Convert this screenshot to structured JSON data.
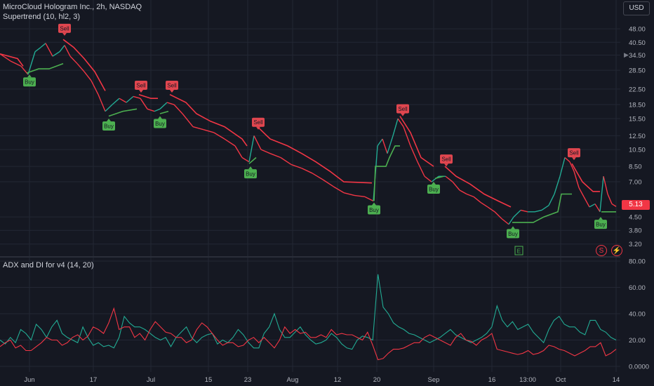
{
  "header": {
    "symbol_line": "MicroCloud Hologram Inc., 2h, NASDAQ",
    "indicator_line": "Supertrend (10, hl2, 3)",
    "lower_indicator_line": "ADX and DI for v4 (14, 20)"
  },
  "currency_button": "USD",
  "last_price": "5.13",
  "event_flags": [
    "S",
    "⚡"
  ],
  "earnings_marker": "E",
  "colors": {
    "background": "#151822",
    "up": "#22ab94",
    "down": "#f23645",
    "supertrend_up": "#4caf50",
    "supertrend_down": "#f23645",
    "grid": "#232734",
    "text": "#b2b5be"
  },
  "chart_data": [
    {
      "type": "line",
      "title": "MicroCloud Hologram Inc., 2h, NASDAQ",
      "scale": "log",
      "x_tick_labels": [
        "Jun",
        "17",
        "Jul",
        "15",
        "23",
        "Aug",
        "12",
        "20",
        "Sep",
        "16",
        "13:00",
        "Oct",
        "14"
      ],
      "y_tick_labels": [
        "48.00",
        "40.50",
        "34.50",
        "28.50",
        "22.50",
        "18.50",
        "15.50",
        "12.50",
        "10.50",
        "8.50",
        "7.00",
        "4.50",
        "3.80",
        "3.20"
      ],
      "ylim": [
        3.0,
        52.0
      ],
      "price_series": [
        {
          "x": 0,
          "y": 35
        },
        {
          "x": 15,
          "y": 32
        },
        {
          "x": 30,
          "y": 30
        },
        {
          "x": 40,
          "y": 27
        },
        {
          "x": 50,
          "y": 36
        },
        {
          "x": 58,
          "y": 38
        },
        {
          "x": 65,
          "y": 40
        },
        {
          "x": 75,
          "y": 34
        },
        {
          "x": 85,
          "y": 36
        },
        {
          "x": 92,
          "y": 39
        },
        {
          "x": 100,
          "y": 34
        },
        {
          "x": 110,
          "y": 31
        },
        {
          "x": 120,
          "y": 28
        },
        {
          "x": 130,
          "y": 25
        },
        {
          "x": 140,
          "y": 21
        },
        {
          "x": 150,
          "y": 17
        },
        {
          "x": 160,
          "y": 18.5
        },
        {
          "x": 170,
          "y": 20
        },
        {
          "x": 180,
          "y": 19
        },
        {
          "x": 190,
          "y": 20.5
        },
        {
          "x": 200,
          "y": 20
        },
        {
          "x": 210,
          "y": 17.5
        },
        {
          "x": 220,
          "y": 17
        },
        {
          "x": 228,
          "y": 17.5
        },
        {
          "x": 238,
          "y": 19
        },
        {
          "x": 248,
          "y": 18.5
        },
        {
          "x": 260,
          "y": 16.5
        },
        {
          "x": 275,
          "y": 14
        },
        {
          "x": 290,
          "y": 13.5
        },
        {
          "x": 305,
          "y": 13
        },
        {
          "x": 320,
          "y": 12
        },
        {
          "x": 335,
          "y": 11
        },
        {
          "x": 345,
          "y": 9.5
        },
        {
          "x": 355,
          "y": 9
        },
        {
          "x": 362,
          "y": 12.5
        },
        {
          "x": 372,
          "y": 10.5
        },
        {
          "x": 385,
          "y": 10
        },
        {
          "x": 400,
          "y": 9.5
        },
        {
          "x": 415,
          "y": 8.7
        },
        {
          "x": 430,
          "y": 8.3
        },
        {
          "x": 445,
          "y": 7.8
        },
        {
          "x": 460,
          "y": 7.2
        },
        {
          "x": 475,
          "y": 6.6
        },
        {
          "x": 490,
          "y": 6.1
        },
        {
          "x": 505,
          "y": 5.9
        },
        {
          "x": 520,
          "y": 5.8
        },
        {
          "x": 532,
          "y": 5.5
        },
        {
          "x": 538,
          "y": 11
        },
        {
          "x": 545,
          "y": 12
        },
        {
          "x": 552,
          "y": 10
        },
        {
          "x": 560,
          "y": 12.5
        },
        {
          "x": 567,
          "y": 15.5
        },
        {
          "x": 575,
          "y": 14
        },
        {
          "x": 585,
          "y": 11
        },
        {
          "x": 595,
          "y": 9
        },
        {
          "x": 605,
          "y": 7.5
        },
        {
          "x": 615,
          "y": 7
        },
        {
          "x": 625,
          "y": 7.5
        },
        {
          "x": 635,
          "y": 7.5
        },
        {
          "x": 645,
          "y": 7
        },
        {
          "x": 655,
          "y": 6.3
        },
        {
          "x": 665,
          "y": 6
        },
        {
          "x": 675,
          "y": 5.8
        },
        {
          "x": 685,
          "y": 5.4
        },
        {
          "x": 695,
          "y": 5.1
        },
        {
          "x": 705,
          "y": 4.8
        },
        {
          "x": 715,
          "y": 4.4
        },
        {
          "x": 725,
          "y": 4.1
        },
        {
          "x": 732,
          "y": 4.5
        },
        {
          "x": 742,
          "y": 4.9
        },
        {
          "x": 752,
          "y": 4.8
        },
        {
          "x": 762,
          "y": 4.8
        },
        {
          "x": 772,
          "y": 4.9
        },
        {
          "x": 782,
          "y": 5.2
        },
        {
          "x": 790,
          "y": 6
        },
        {
          "x": 798,
          "y": 7.5
        },
        {
          "x": 805,
          "y": 9.5
        },
        {
          "x": 812,
          "y": 9
        },
        {
          "x": 818,
          "y": 8
        },
        {
          "x": 825,
          "y": 6.5
        },
        {
          "x": 832,
          "y": 5.8
        },
        {
          "x": 840,
          "y": 5.1
        },
        {
          "x": 848,
          "y": 5.3
        },
        {
          "x": 855,
          "y": 4.8
        },
        {
          "x": 860,
          "y": 7.5
        },
        {
          "x": 866,
          "y": 6
        },
        {
          "x": 872,
          "y": 5.3
        },
        {
          "x": 878,
          "y": 5.13
        }
      ],
      "supertrend_segments": [
        {
          "dir": "down",
          "points": [
            {
              "x": 0,
              "y": 35
            },
            {
              "x": 25,
              "y": 33
            },
            {
              "x": 33,
              "y": 30
            }
          ]
        },
        {
          "dir": "up",
          "points": [
            {
              "x": 38,
              "y": 27.5
            },
            {
              "x": 55,
              "y": 29
            },
            {
              "x": 70,
              "y": 29
            },
            {
              "x": 90,
              "y": 31
            }
          ]
        },
        {
          "dir": "down",
          "points": [
            {
              "x": 90,
              "y": 42
            },
            {
              "x": 105,
              "y": 38
            },
            {
              "x": 120,
              "y": 33
            },
            {
              "x": 135,
              "y": 28
            },
            {
              "x": 150,
              "y": 22
            }
          ]
        },
        {
          "dir": "up",
          "points": [
            {
              "x": 155,
              "y": 16
            },
            {
              "x": 175,
              "y": 17
            },
            {
              "x": 195,
              "y": 17.5
            }
          ]
        },
        {
          "dir": "down",
          "points": [
            {
              "x": 198,
              "y": 21
            },
            {
              "x": 215,
              "y": 20
            },
            {
              "x": 225,
              "y": 20
            }
          ]
        },
        {
          "dir": "up",
          "points": [
            {
              "x": 228,
              "y": 16.5
            },
            {
              "x": 240,
              "y": 17
            }
          ]
        },
        {
          "dir": "down",
          "points": [
            {
              "x": 242,
              "y": 21
            },
            {
              "x": 265,
              "y": 19
            },
            {
              "x": 280,
              "y": 16.5
            },
            {
              "x": 300,
              "y": 15
            },
            {
              "x": 320,
              "y": 14
            },
            {
              "x": 345,
              "y": 12
            },
            {
              "x": 352,
              "y": 11
            }
          ]
        },
        {
          "dir": "up",
          "points": [
            {
              "x": 355,
              "y": 8.8
            },
            {
              "x": 365,
              "y": 9.5
            }
          ]
        },
        {
          "dir": "down",
          "points": [
            {
              "x": 367,
              "y": 14
            },
            {
              "x": 385,
              "y": 12
            },
            {
              "x": 410,
              "y": 11
            },
            {
              "x": 430,
              "y": 10
            },
            {
              "x": 450,
              "y": 9
            },
            {
              "x": 470,
              "y": 8
            },
            {
              "x": 490,
              "y": 7
            },
            {
              "x": 530,
              "y": 6.9
            }
          ]
        },
        {
          "dir": "up",
          "points": [
            {
              "x": 533,
              "y": 5.5
            },
            {
              "x": 535,
              "y": 8.5
            },
            {
              "x": 550,
              "y": 8.5
            },
            {
              "x": 555,
              "y": 9.5
            },
            {
              "x": 563,
              "y": 11
            },
            {
              "x": 570,
              "y": 11
            }
          ]
        },
        {
          "dir": "down",
          "points": [
            {
              "x": 570,
              "y": 16
            },
            {
              "x": 585,
              "y": 13
            },
            {
              "x": 600,
              "y": 9.5
            },
            {
              "x": 618,
              "y": 8.5
            }
          ]
        },
        {
          "dir": "up",
          "points": [
            {
              "x": 620,
              "y": 7.3
            },
            {
              "x": 632,
              "y": 7.5
            }
          ]
        },
        {
          "dir": "down",
          "points": [
            {
              "x": 634,
              "y": 8.5
            },
            {
              "x": 650,
              "y": 7.5
            },
            {
              "x": 670,
              "y": 6.8
            },
            {
              "x": 690,
              "y": 6
            },
            {
              "x": 710,
              "y": 5.5
            },
            {
              "x": 728,
              "y": 5.1
            }
          ]
        },
        {
          "dir": "up",
          "points": [
            {
              "x": 730,
              "y": 4.2
            },
            {
              "x": 760,
              "y": 4.2
            },
            {
              "x": 775,
              "y": 4.5
            },
            {
              "x": 795,
              "y": 4.8
            },
            {
              "x": 800,
              "y": 6
            },
            {
              "x": 815,
              "y": 6
            }
          ]
        },
        {
          "dir": "down",
          "points": [
            {
              "x": 815,
              "y": 8.8
            },
            {
              "x": 830,
              "y": 7
            },
            {
              "x": 845,
              "y": 6.2
            },
            {
              "x": 855,
              "y": 6.2
            }
          ]
        },
        {
          "dir": "up",
          "points": [
            {
              "x": 857,
              "y": 4.8
            },
            {
              "x": 878,
              "y": 4.8
            }
          ]
        }
      ],
      "signals": [
        {
          "type": "sell",
          "label": "Sell",
          "x": 92,
          "y": 44
        },
        {
          "type": "sell",
          "label": "Sell",
          "x": 201,
          "y": 21.5
        },
        {
          "type": "sell",
          "label": "Sell",
          "x": 245,
          "y": 21.5
        },
        {
          "type": "sell",
          "label": "Sell",
          "x": 368,
          "y": 13.5
        },
        {
          "type": "sell",
          "label": "Sell",
          "x": 574,
          "y": 16
        },
        {
          "type": "sell",
          "label": "Sell",
          "x": 636,
          "y": 8.5
        },
        {
          "type": "sell",
          "label": "Sell",
          "x": 818,
          "y": 9.2
        },
        {
          "type": "buy",
          "label": "Buy",
          "x": 42,
          "y": 27
        },
        {
          "type": "buy",
          "label": "Buy",
          "x": 155,
          "y": 15.5
        },
        {
          "type": "buy",
          "label": "Buy",
          "x": 228,
          "y": 16
        },
        {
          "type": "buy",
          "label": "Buy",
          "x": 357,
          "y": 8.5
        },
        {
          "type": "buy",
          "label": "Buy",
          "x": 533,
          "y": 5.4
        },
        {
          "type": "buy",
          "label": "Buy",
          "x": 618,
          "y": 7.0
        },
        {
          "type": "buy",
          "label": "Buy",
          "x": 731,
          "y": 4.0
        },
        {
          "type": "buy",
          "label": "Buy",
          "x": 856,
          "y": 4.5
        }
      ]
    },
    {
      "type": "line",
      "title": "ADX and DI for v4 (14, 20)",
      "y_tick_labels": [
        "80.00",
        "60.00",
        "40.00",
        "20.00",
        "0.0000"
      ],
      "ylim": [
        0,
        80
      ],
      "series": [
        {
          "color": "#22ab94",
          "values": [
            20,
            17,
            22,
            18,
            28,
            25,
            20,
            32,
            28,
            22,
            30,
            35,
            25,
            22,
            20,
            18,
            30,
            22,
            16,
            18,
            15,
            16,
            14,
            22,
            38,
            33,
            30,
            30,
            28,
            25,
            22,
            20,
            22,
            15,
            22,
            26,
            30,
            22,
            18,
            22,
            24,
            25,
            17,
            20,
            18,
            22,
            28,
            24,
            18,
            14,
            14,
            25,
            30,
            40,
            28,
            22,
            22,
            26,
            30,
            24,
            20,
            17,
            18,
            20,
            25,
            22,
            17,
            14,
            13,
            20,
            23,
            22,
            20,
            70,
            45,
            40,
            33,
            30,
            28,
            25,
            24,
            22,
            20,
            18,
            20,
            22,
            25,
            28,
            24,
            22,
            20,
            18,
            20,
            22,
            25,
            30,
            46,
            35,
            30,
            34,
            28,
            30,
            32,
            26,
            22,
            18,
            28,
            35,
            38,
            32,
            30,
            30,
            26,
            24,
            35,
            35,
            28,
            26,
            22,
            20
          ]
        },
        {
          "color": "#f23645",
          "values": [
            15,
            18,
            20,
            14,
            16,
            12,
            12,
            15,
            18,
            22,
            20,
            20,
            16,
            18,
            22,
            24,
            20,
            23,
            30,
            28,
            25,
            33,
            44,
            28,
            30,
            30,
            22,
            25,
            20,
            28,
            34,
            30,
            26,
            25,
            22,
            22,
            18,
            20,
            28,
            33,
            30,
            25,
            20,
            16,
            18,
            18,
            15,
            16,
            20,
            22,
            18,
            22,
            18,
            14,
            20,
            30,
            25,
            28,
            25,
            26,
            22,
            22,
            24,
            22,
            28,
            24,
            25,
            24,
            24,
            22,
            20,
            26,
            16,
            5,
            6,
            10,
            13,
            13,
            14,
            16,
            18,
            18,
            22,
            24,
            22,
            20,
            18,
            16,
            22,
            25,
            20,
            19,
            16,
            20,
            22,
            25,
            13,
            12,
            11,
            10,
            9,
            10,
            12,
            9,
            10,
            12,
            16,
            15,
            13,
            12,
            10,
            8,
            10,
            12,
            15,
            15,
            18,
            8,
            10,
            13
          ]
        }
      ]
    }
  ]
}
